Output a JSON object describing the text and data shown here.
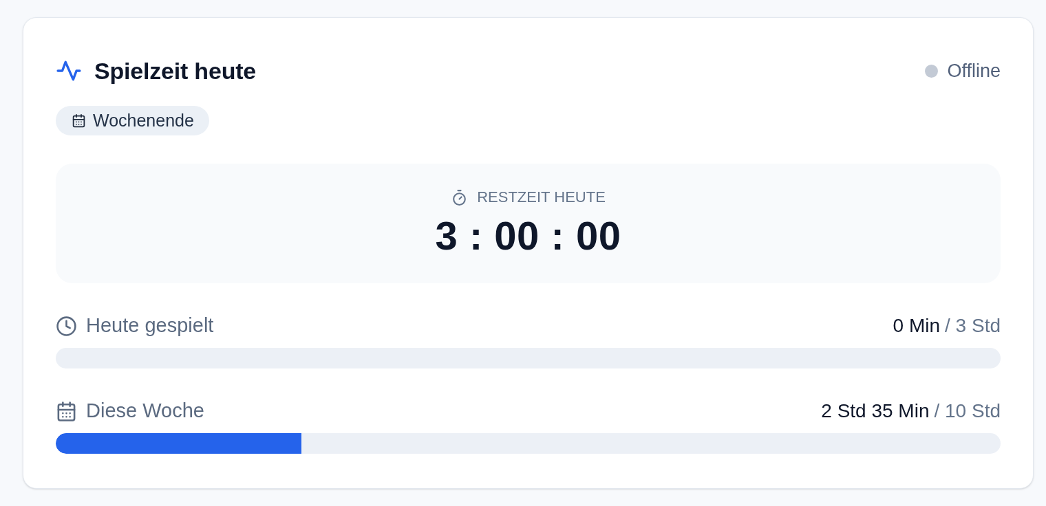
{
  "card": {
    "title": "Spielzeit heute",
    "status": {
      "label": "Offline",
      "online": false
    },
    "badge": {
      "label": "Wochenende"
    },
    "countdown": {
      "label": "RESTZEIT HEUTE",
      "value": "3 : 00 : 00"
    },
    "meters": [
      {
        "kind": "clock",
        "label": "Heute gespielt",
        "used": "0 Min",
        "limit": "/ 3 Std",
        "level": 0
      },
      {
        "kind": "calendar",
        "label": "Diese Woche",
        "used": "2 Std 35 Min",
        "limit": "/ 10 Std",
        "level": 0.26
      }
    ]
  }
}
